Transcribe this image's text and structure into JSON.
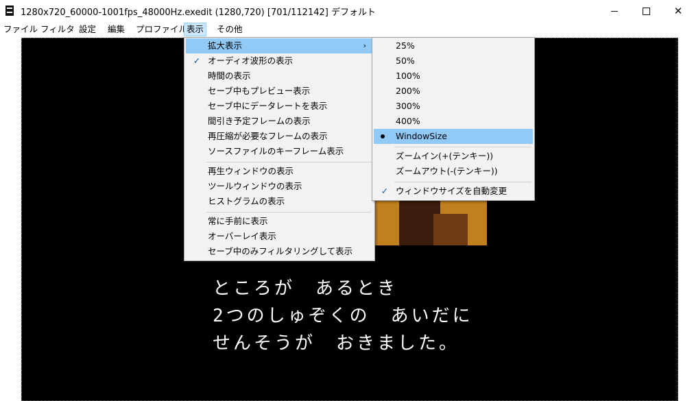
{
  "window": {
    "title": "1280x720_60000-1001fps_48000Hz.exedit (1280,720)  [701/112142]  デフォルト",
    "icon": "app-icon",
    "controls": {
      "minimize": "minimize-icon",
      "maximize": "maximize-icon",
      "close": "✕"
    }
  },
  "menubar": {
    "items": [
      {
        "label": "ファイル"
      },
      {
        "label": "フィルタ"
      },
      {
        "label": "設定"
      },
      {
        "label": "編集"
      },
      {
        "label": "プロファイル"
      },
      {
        "label": "表示",
        "active": true
      },
      {
        "label": "その他"
      }
    ]
  },
  "view_menu": {
    "items": [
      {
        "label": "拡大表示",
        "highlighted": true,
        "submenu": true
      },
      {
        "label": "オーディオ波形の表示",
        "checked": true
      },
      {
        "label": "時間の表示"
      },
      {
        "label": "セーブ中もプレビュー表示"
      },
      {
        "label": "セーブ中にデータレートを表示"
      },
      {
        "label": "間引き予定フレームの表示"
      },
      {
        "label": "再圧縮が必要なフレームの表示"
      },
      {
        "label": "ソースファイルのキーフレーム表示"
      },
      {
        "label": "再生ウィンドウの表示"
      },
      {
        "label": "ツールウィンドウの表示"
      },
      {
        "label": "ヒストグラムの表示"
      },
      {
        "label": "常に手前に表示"
      },
      {
        "label": "オーバーレイ表示"
      },
      {
        "label": "セーブ中のみフィルタリングして表示"
      }
    ],
    "arrow": "›"
  },
  "zoom_submenu": {
    "items": [
      {
        "label": "25%"
      },
      {
        "label": "50%"
      },
      {
        "label": "100%"
      },
      {
        "label": "200%"
      },
      {
        "label": "300%"
      },
      {
        "label": "400%"
      },
      {
        "label": "WindowSize",
        "selected": true
      },
      {
        "label": "ズームイン(+(テンキー))"
      },
      {
        "label": "ズームアウト(-(テンキー))"
      },
      {
        "label": "ウィンドウサイズを自動変更",
        "checked": true
      }
    ],
    "check_glyph": "✓"
  },
  "preview": {
    "lines": [
      "ところが　あるとき",
      "2つのしゅぞくの　あいだに",
      "せんそうが　おきました。"
    ]
  },
  "colors": {
    "highlight": "#91c9f7",
    "menu_bg": "#f2f2f2",
    "active_menu_bg": "#cce8ff",
    "preview_bg": "#000000"
  }
}
